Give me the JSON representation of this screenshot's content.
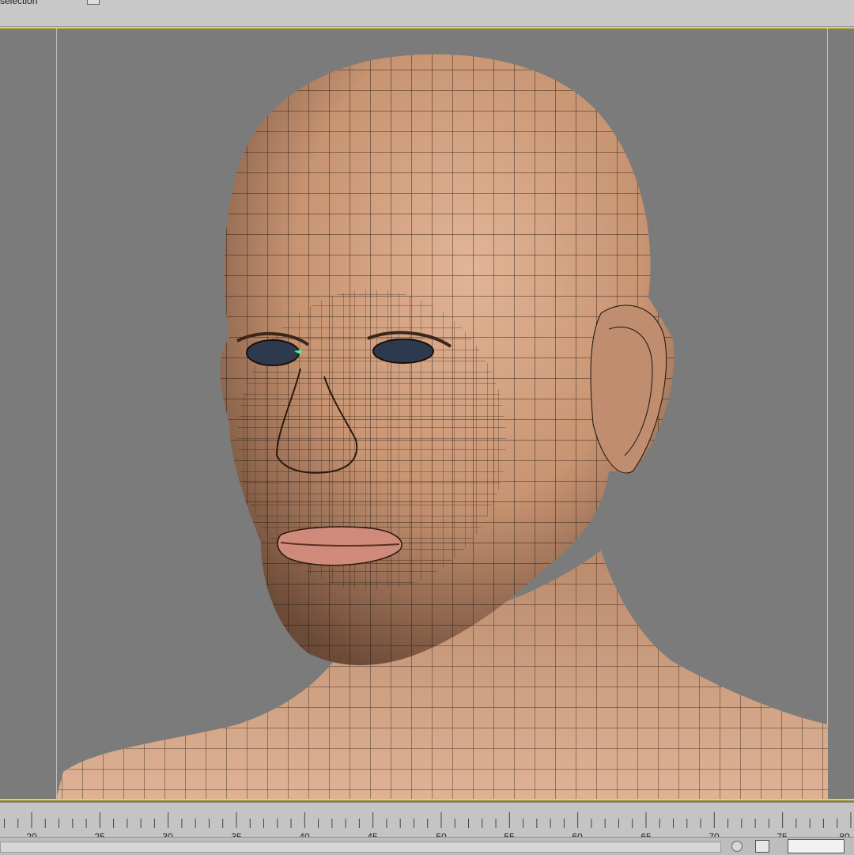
{
  "window": {
    "title": "selection"
  },
  "viewport": {
    "frame_color": "#e8e000",
    "background": "#7b7b7b"
  },
  "timeline": {
    "tick_labels": [
      "20",
      "25",
      "30",
      "35",
      "40",
      "45",
      "50",
      "55",
      "60",
      "65",
      "70",
      "75",
      "80"
    ]
  },
  "icons": [
    "key-icon",
    "grid-icon"
  ]
}
